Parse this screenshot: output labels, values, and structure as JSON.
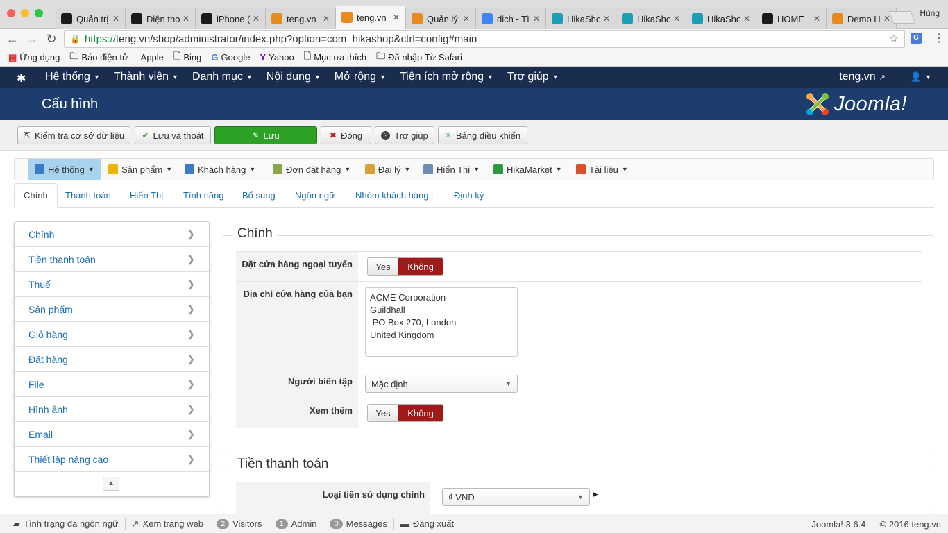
{
  "browser": {
    "tabs": [
      {
        "label": "Quản trị",
        "icon": "joomla-icon",
        "color": "#1a1a1a"
      },
      {
        "label": "Điện thoại",
        "icon": "joomla-icon",
        "color": "#1a1a1a"
      },
      {
        "label": "iPhone (",
        "icon": "joomla-icon",
        "color": "#1a1a1a"
      },
      {
        "label": "teng.vn",
        "icon": "joomla-color-icon",
        "color": "#e88a1e"
      },
      {
        "label": "teng.vn",
        "icon": "joomla-color-icon",
        "color": "#e88a1e",
        "active": true
      },
      {
        "label": "Quản lý",
        "icon": "joomla-color-icon",
        "color": "#e88a1e"
      },
      {
        "label": "dich - Tì",
        "icon": "google-icon",
        "color": "#4285f4"
      },
      {
        "label": "HikaShop",
        "icon": "hikashop-icon",
        "color": "#1aa0b5"
      },
      {
        "label": "HikaShop",
        "icon": "hikashop-icon",
        "color": "#1aa0b5"
      },
      {
        "label": "HikaShop",
        "icon": "hikashop-icon",
        "color": "#1aa0b5"
      },
      {
        "label": "HOME",
        "icon": "joomla-icon",
        "color": "#1a1a1a"
      },
      {
        "label": "Demo H",
        "icon": "joomla-color-icon",
        "color": "#e88a1e"
      }
    ],
    "tab_close": "✕",
    "profile": "Hùng",
    "url_https": "https://",
    "url_rest": "teng.vn/shop/administrator/index.php?option=com_hikashop&ctrl=config#main",
    "bookmarks": [
      {
        "label": "Ứng dụng",
        "icon": "apps-grid-icon"
      },
      {
        "label": "Báo điện tử",
        "icon": "folder-icon"
      },
      {
        "label": "Apple",
        "icon": "apple-icon"
      },
      {
        "label": "Bing",
        "icon": "page-icon"
      },
      {
        "label": "Google",
        "icon": "google-g-icon"
      },
      {
        "label": "Yahoo",
        "icon": "yahoo-icon"
      },
      {
        "label": "Mục ưa thích",
        "icon": "page-icon"
      },
      {
        "label": "Đã nhập Từ Safari",
        "icon": "folder-icon"
      }
    ]
  },
  "joomla_nav": {
    "items": [
      "Hệ thống",
      "Thành viên",
      "Danh mục",
      "Nội dung",
      "Mở rộng",
      "Tiện ích mở rộng",
      "Trợ giúp"
    ],
    "site_link": "teng.vn",
    "user_icon": "👤"
  },
  "header": {
    "title": "Cấu hình",
    "brand": "Joomla!"
  },
  "toolbar": {
    "buttons": [
      {
        "label": "Kiểm tra cơ sở dữ liệu",
        "icon": "database-check-icon",
        "glyph": "⇱"
      },
      {
        "label": "Lưu và thoát",
        "icon": "check-icon",
        "glyph": "✔"
      },
      {
        "label": "Lưu",
        "icon": "edit-icon",
        "glyph": "✎"
      },
      {
        "label": "Đóng",
        "icon": "close-circle-icon",
        "glyph": "✖"
      },
      {
        "label": "Trợ giúp",
        "icon": "question-icon",
        "glyph": "?"
      },
      {
        "label": "Bảng điều khiển",
        "icon": "hikashop-icon",
        "glyph": "✳"
      }
    ]
  },
  "hika_menu": [
    {
      "label": "Hệ thống",
      "icon": "wrench-icon",
      "color": "#3a7bc8"
    },
    {
      "label": "Sản phẩm",
      "icon": "product-icon",
      "color": "#f0b400"
    },
    {
      "label": "Khách hàng",
      "icon": "customer-icon",
      "color": "#3a7bc8"
    },
    {
      "label": "Đơn đặt hàng",
      "icon": "order-icon",
      "color": "#8aa64a"
    },
    {
      "label": "Đại lý",
      "icon": "affiliate-icon",
      "color": "#d9a035"
    },
    {
      "label": "Hiển Thị",
      "icon": "display-icon",
      "color": "#6a8fb5"
    },
    {
      "label": "HikaMarket",
      "icon": "hikamarket-icon",
      "color": "#2a9a3a"
    },
    {
      "label": "Tài liệu",
      "icon": "lifebuoy-icon",
      "color": "#d9502a"
    }
  ],
  "config_tabs": [
    "Chính",
    "Thanh toán",
    "Hiển Thị",
    "Tính năng",
    "Bổ sung",
    "Ngôn ngữ",
    "Nhóm khách hàng :",
    "Định kỳ"
  ],
  "side_menu": [
    "Chính",
    "Tiền thanh toán",
    "Thuế",
    "Sản phẩm",
    "Giỏ hàng",
    "Đặt hàng",
    "File",
    "Hình ảnh",
    "Email",
    "Thiết lập nâng cao"
  ],
  "section_main": {
    "legend": "Chính",
    "offline_label": "Đặt cửa hàng ngoại tuyến",
    "yes": "Yes",
    "no": "Không",
    "address_label": "Địa chỉ cửa hàng của bạn",
    "address_value": "ACME Corporation\nGuildhall\n PO Box 270, London\nUnited Kingdom",
    "editor_label": "Người biên tập",
    "editor_value": "Mặc định",
    "readmore_label": "Xem thêm"
  },
  "section_payment": {
    "legend": "Tiền thanh toán",
    "currency_label": "Loại tiền sử dụng chính",
    "currency_value": "₫ VND"
  },
  "statusbar": {
    "multilang": "Tình trạng đa ngôn ngữ",
    "view_site": "Xem trang web",
    "visitors_count": "2",
    "visitors": "Visitors",
    "admin_count": "1",
    "admin": "Admin",
    "messages_count": "0",
    "messages": "Messages",
    "logout": "Đăng xuất",
    "version": "Joomla! 3.6.4  —  © 2016 teng.vn"
  }
}
